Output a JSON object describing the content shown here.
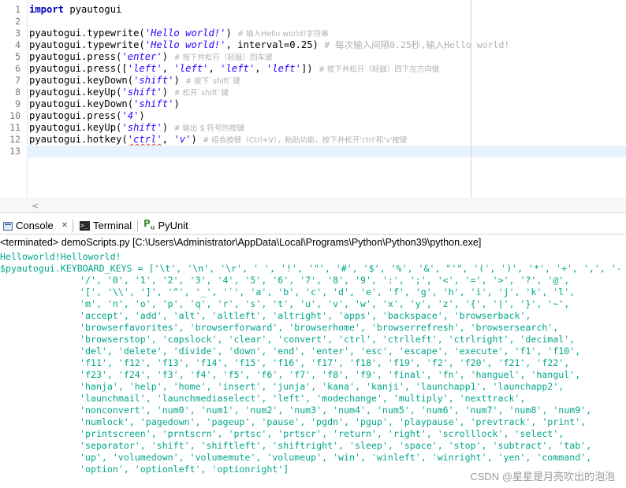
{
  "editor": {
    "line_numbers": [
      "1",
      "2",
      "3",
      "4",
      "5",
      "6",
      "7",
      "8",
      "9",
      "10",
      "11",
      "12",
      "13"
    ],
    "lines": [
      {
        "segments": [
          {
            "t": "import",
            "c": "kw"
          },
          {
            "t": " pyautogui",
            "c": ""
          }
        ]
      },
      {
        "segments": []
      },
      {
        "segments": [
          {
            "t": "pyautogui.typewrite(",
            "c": ""
          },
          {
            "t": "'Hello world!'",
            "c": "str"
          },
          {
            "t": ") ",
            "c": ""
          },
          {
            "t": "# 输入Hello world!字符串",
            "c": "cmt"
          }
        ]
      },
      {
        "segments": [
          {
            "t": "pyautogui.typewrite(",
            "c": ""
          },
          {
            "t": "'Hello world!'",
            "c": "str"
          },
          {
            "t": ", interval=0.25) ",
            "c": ""
          },
          {
            "t": "# 每次输入间隔0.25秒,输入Hello world!",
            "c": "cmt big"
          }
        ]
      },
      {
        "segments": [
          {
            "t": "pyautogui.press(",
            "c": ""
          },
          {
            "t": "'enter'",
            "c": "str"
          },
          {
            "t": ") ",
            "c": ""
          },
          {
            "t": "# 按下并松开（轻敲）回车键",
            "c": "cmt"
          }
        ]
      },
      {
        "segments": [
          {
            "t": "pyautogui.press([",
            "c": ""
          },
          {
            "t": "'left'",
            "c": "str"
          },
          {
            "t": ", ",
            "c": ""
          },
          {
            "t": "'left'",
            "c": "str"
          },
          {
            "t": ", ",
            "c": ""
          },
          {
            "t": "'left'",
            "c": "str"
          },
          {
            "t": ", ",
            "c": ""
          },
          {
            "t": "'left'",
            "c": "str"
          },
          {
            "t": "]) ",
            "c": ""
          },
          {
            "t": "# 按下并松开（轻敲）四下左方向键",
            "c": "cmt"
          }
        ]
      },
      {
        "segments": [
          {
            "t": "pyautogui.keyDown(",
            "c": ""
          },
          {
            "t": "'shift'",
            "c": "str"
          },
          {
            "t": ") ",
            "c": ""
          },
          {
            "t": "# 按下`shift`键",
            "c": "cmt"
          }
        ]
      },
      {
        "segments": [
          {
            "t": "pyautogui.keyUp(",
            "c": ""
          },
          {
            "t": "'shift'",
            "c": "str"
          },
          {
            "t": ") ",
            "c": ""
          },
          {
            "t": "# 松开`shift`键",
            "c": "cmt"
          }
        ]
      },
      {
        "segments": [
          {
            "t": "pyautogui.keyDown(",
            "c": ""
          },
          {
            "t": "'shift'",
            "c": "str"
          },
          {
            "t": ")",
            "c": ""
          }
        ]
      },
      {
        "segments": [
          {
            "t": "pyautogui.press(",
            "c": ""
          },
          {
            "t": "'4'",
            "c": "str"
          },
          {
            "t": ")",
            "c": ""
          }
        ]
      },
      {
        "segments": [
          {
            "t": "pyautogui.keyUp(",
            "c": ""
          },
          {
            "t": "'shift'",
            "c": "str"
          },
          {
            "t": ") ",
            "c": ""
          },
          {
            "t": "# 输出 $ 符号的按键",
            "c": "cmt"
          }
        ]
      },
      {
        "segments": [
          {
            "t": "pyautogui.hotkey(",
            "c": ""
          },
          {
            "t": "'ctrl'",
            "c": "str squig"
          },
          {
            "t": ", ",
            "c": ""
          },
          {
            "t": "'v'",
            "c": "str"
          },
          {
            "t": ") ",
            "c": ""
          },
          {
            "t": "# 组合按键（Ctrl+V），粘贴功能，按下并松开'ctrl'和'v'按键",
            "c": "cmt"
          }
        ]
      },
      {
        "segments": []
      }
    ],
    "current_line": 13
  },
  "tabs": {
    "console": "Console",
    "console_close": "✕",
    "terminal": "Terminal",
    "pyunit": "PyUnit"
  },
  "console": {
    "terminated_line": "<terminated> demoScripts.py [C:\\Users\\Administrator\\AppData\\Local\\Programs\\Python\\Python39\\python.exe]",
    "output_first": "Helloworld!Helloworld!",
    "output_rows": [
      "$pyautogui.KEYBOARD_KEYS = ['\\t', '\\n', '\\r', ' ', '!', '\"', '#', '$', '%', '&', \"'\", '(', ')', '*', '+', ',', '-",
      "'/', '0', '1', '2', '3', '4', '5', '6', '7', '8', '9', ':', ';', '<', '=', '>', '?', '@',",
      "'[', '\\\\', ']', '^', '_', '`', 'a', 'b', 'c', 'd', 'e', 'f', 'g', 'h', 'i', 'j', 'k', 'l',",
      "'m', 'n', 'o', 'p', 'q', 'r', 's', 't', 'u', 'v', 'w', 'x', 'y', 'z', '{', '|', '}', '~',",
      "'accept', 'add', 'alt', 'altleft', 'altright', 'apps', 'backspace', 'browserback',",
      "'browserfavorites', 'browserforward', 'browserhome', 'browserrefresh', 'browsersearch',",
      "'browserstop', 'capslock', 'clear', 'convert', 'ctrl', 'ctrlleft', 'ctrlright', 'decimal',",
      "'del', 'delete', 'divide', 'down', 'end', 'enter', 'esc', 'escape', 'execute', 'f1', 'f10',",
      "'f11', 'f12', 'f13', 'f14', 'f15', 'f16', 'f17', 'f18', 'f19', 'f2', 'f20', 'f21', 'f22',",
      "'f23', 'f24', 'f3', 'f4', 'f5', 'f6', 'f7', 'f8', 'f9', 'final', 'fn', 'hanguel', 'hangul',",
      "'hanja', 'help', 'home', 'insert', 'junja', 'kana', 'kanji', 'launchapp1', 'launchapp2',",
      "'launchmail', 'launchmediaselect', 'left', 'modechange', 'multiply', 'nexttrack',",
      "'nonconvert', 'num0', 'num1', 'num2', 'num3', 'num4', 'num5', 'num6', 'num7', 'num8', 'num9',",
      "'numlock', 'pagedown', 'pageup', 'pause', 'pgdn', 'pgup', 'playpause', 'prevtrack', 'print',",
      "'printscreen', 'prntscrn', 'prtsc', 'prtscr', 'return', 'right', 'scrolllock', 'select',",
      "'separator', 'shift', 'shiftleft', 'shiftright', 'sleep', 'space', 'stop', 'subtract', 'tab',",
      "'up', 'volumedown', 'volumemute', 'volumeup', 'win', 'winleft', 'winright', 'yen', 'command',",
      "'option', 'optionleft', 'optionright']"
    ]
  },
  "watermark": "CSDN @星星是月亮吹出的泡泡",
  "scroll_arrow": "<"
}
